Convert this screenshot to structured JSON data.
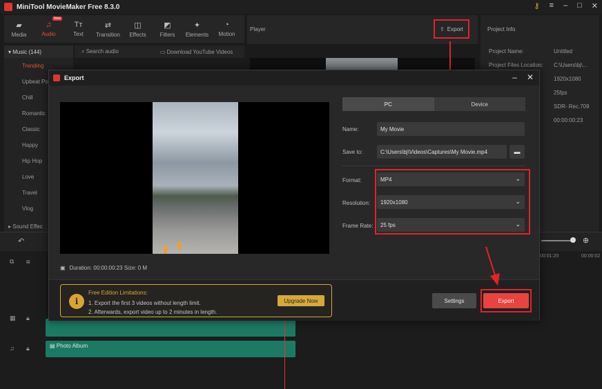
{
  "app": {
    "title": "MiniTool MovieMaker Free 8.3.0"
  },
  "toolbar": {
    "items": [
      {
        "label": "Media",
        "icon": "folder-icon"
      },
      {
        "label": "Audio",
        "icon": "music-note-icon",
        "badge": "New"
      },
      {
        "label": "Text",
        "icon": "text-icon"
      },
      {
        "label": "Transition",
        "icon": "transition-icon"
      },
      {
        "label": "Effects",
        "icon": "effects-icon"
      },
      {
        "label": "Filters",
        "icon": "filters-icon"
      },
      {
        "label": "Elements",
        "icon": "elements-icon"
      },
      {
        "label": "Motion",
        "icon": "motion-icon"
      }
    ]
  },
  "sidebar": {
    "header": "Music (144)",
    "items": [
      "Trending",
      "Upbeat Po",
      "Chill",
      "Romantic",
      "Classic",
      "Happy",
      "Hip Hop",
      "Love",
      "Travel",
      "Vlog"
    ],
    "footer": "Sound Effec"
  },
  "audio_search": {
    "placeholder": "Search audio",
    "download": "Download YouTube Videos"
  },
  "player": {
    "label": "Player",
    "export": "Export"
  },
  "project_info": {
    "title": "Project Info",
    "rows": [
      {
        "label": "Project Name:",
        "value": "Untitled"
      },
      {
        "label": "Project Files Location:",
        "value": "C:\\Users\\bj\\..."
      },
      {
        "label": "",
        "value": "1920x1080"
      },
      {
        "label": "",
        "value": "25fps"
      },
      {
        "label": "",
        "value": "SDR- Rec.709"
      },
      {
        "label": "",
        "value": "00:00:00:23"
      }
    ]
  },
  "timeline": {
    "tracks": [
      {
        "label": ""
      },
      {
        "label": "Photo Album"
      }
    ],
    "time_marks": [
      "00:01:20",
      "00:00:02"
    ]
  },
  "export_dialog": {
    "title": "Export",
    "tabs": [
      "PC",
      "Device"
    ],
    "name_label": "Name:",
    "name_value": "My Movie",
    "save_label": "Save to:",
    "save_value": "C:\\Users\\bj\\Videos\\Captures\\My Movie.mp4",
    "format_label": "Format:",
    "format_value": "MP4",
    "resolution_label": "Resolution:",
    "resolution_value": "1920x1080",
    "framerate_label": "Frame Rate:",
    "framerate_value": "25 fps",
    "duration_text": "Duration:  00:00:00:23  Size:  0 M",
    "limit_title": "Free Edition Limitations:",
    "limit_line1": "1. Export the first 3 videos without length limit.",
    "limit_line2": "2. Afterwards, export video up to 2 minutes in length.",
    "upgrade": "Upgrade Now",
    "settings": "Settings",
    "export": "Export"
  },
  "colors": {
    "accent": "#e94e3a",
    "highlight_red": "#e0242a",
    "gold": "#d5a93a",
    "track_green": "#1c7a63"
  }
}
